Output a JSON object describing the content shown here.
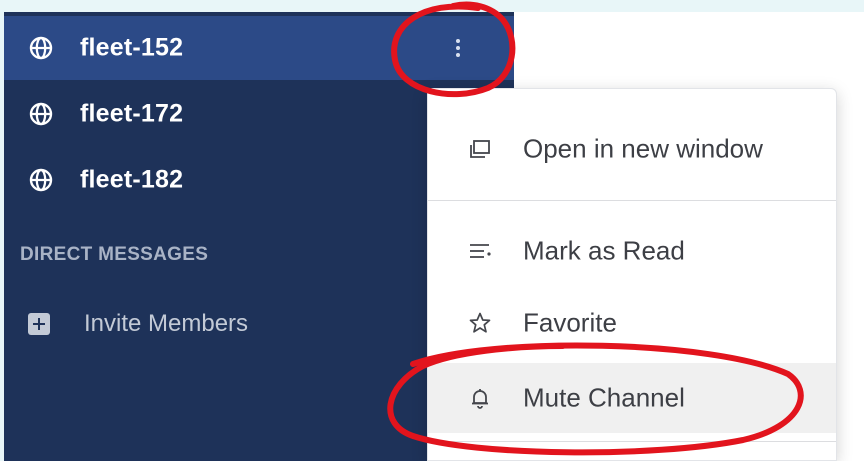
{
  "sidebar": {
    "channels": [
      {
        "label": "fleet-152",
        "icon": "globe-icon",
        "active": true
      },
      {
        "label": "fleet-172",
        "icon": "globe-icon",
        "active": false
      },
      {
        "label": "fleet-182",
        "icon": "globe-icon",
        "active": false
      }
    ],
    "direct_messages_title": "DIRECT MESSAGES",
    "invite_label": "Invite Members"
  },
  "context_menu": {
    "items": [
      {
        "label": "Open in new window",
        "icon": "new-window-icon"
      },
      {
        "label": "Mark as Read",
        "icon": "mark-read-icon"
      },
      {
        "label": "Favorite",
        "icon": "star-icon"
      },
      {
        "label": "Mute Channel",
        "icon": "bell-icon",
        "highlighted": true
      }
    ]
  },
  "colors": {
    "sidebar_bg": "#1e3259",
    "active_row": "#2c4a87",
    "annotation": "#e2141d",
    "page_bg": "#e8f6f8"
  }
}
